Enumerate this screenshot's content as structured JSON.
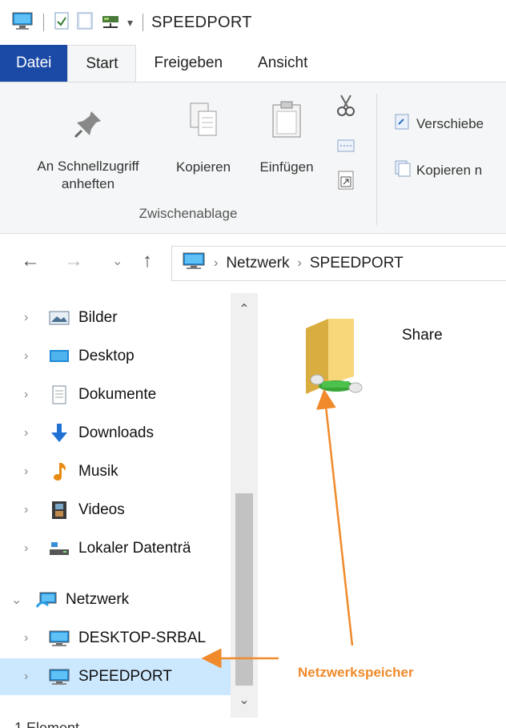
{
  "window": {
    "title": "SPEEDPORT"
  },
  "ribbon": {
    "tabs": [
      {
        "label": "Datei"
      },
      {
        "label": "Start"
      },
      {
        "label": "Freigeben"
      },
      {
        "label": "Ansicht"
      }
    ],
    "pin": {
      "line1": "An Schnellzugriff",
      "line2": "anheften"
    },
    "copy": "Kopieren",
    "paste": "Einfügen",
    "group_label": "Zwischenablage",
    "move_to": "Verschiebe",
    "copy_to": "Kopieren n"
  },
  "address": {
    "crumbs": [
      "Netzwerk",
      "SPEEDPORT"
    ],
    "separator": "›"
  },
  "nav": {
    "items": [
      {
        "label": "Bilder",
        "icon": "pictures-icon"
      },
      {
        "label": "Desktop",
        "icon": "desktop-icon"
      },
      {
        "label": "Dokumente",
        "icon": "documents-icon"
      },
      {
        "label": "Downloads",
        "icon": "downloads-icon"
      },
      {
        "label": "Musik",
        "icon": "music-icon"
      },
      {
        "label": "Videos",
        "icon": "videos-icon"
      },
      {
        "label": "Lokaler Datenträ",
        "icon": "local-drive-icon"
      },
      {
        "label": "Netzwerk",
        "icon": "network-icon"
      },
      {
        "label": "DESKTOP-SRBAL",
        "icon": "computer-icon"
      },
      {
        "label": "SPEEDPORT",
        "icon": "computer-icon",
        "selected": true
      }
    ]
  },
  "content": {
    "items": [
      {
        "label": "Share",
        "icon": "network-share-folder-icon"
      }
    ]
  },
  "status": {
    "text": "1 Element"
  },
  "annotation": {
    "label": "Netzwerkspeicher",
    "color": "#f08a2a"
  },
  "colors": {
    "file_tab": "#1b4aa6",
    "selected_row": "#cce8ff",
    "annotation": "#f08a2a"
  }
}
